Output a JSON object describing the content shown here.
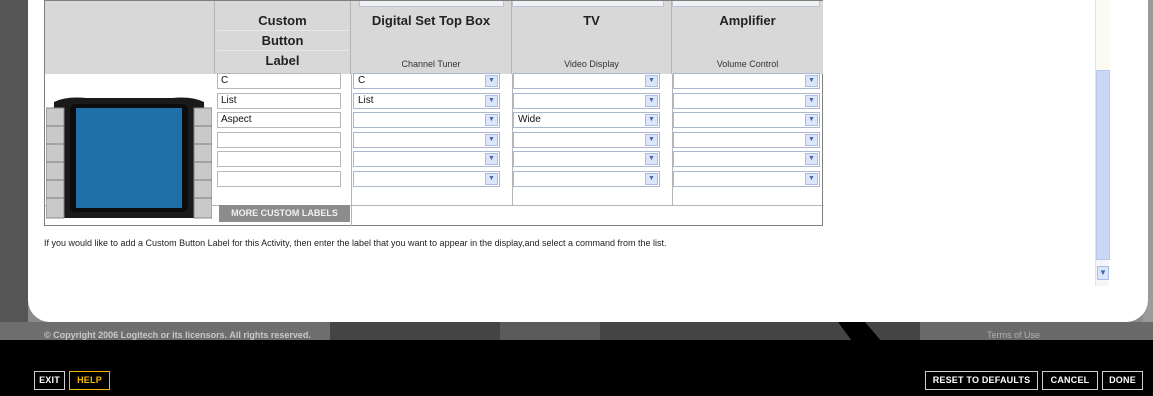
{
  "table": {
    "columns": [
      {
        "title": "Custom Button Label",
        "title_lines": [
          "Custom",
          "Button",
          "Label"
        ],
        "subtitle": ""
      },
      {
        "title": "Digital Set Top Box",
        "subtitle": "Channel Tuner"
      },
      {
        "title": "TV",
        "subtitle": "Video Display"
      },
      {
        "title": "Amplifier",
        "subtitle": "Volume Control"
      }
    ],
    "rows": [
      {
        "label": "C",
        "set_top_box": "C",
        "tv": "",
        "amplifier": ""
      },
      {
        "label": "List",
        "set_top_box": "List",
        "tv": "",
        "amplifier": ""
      },
      {
        "label": "Aspect",
        "set_top_box": "",
        "tv": "Wide",
        "amplifier": ""
      },
      {
        "label": "",
        "set_top_box": "",
        "tv": "",
        "amplifier": ""
      },
      {
        "label": "",
        "set_top_box": "",
        "tv": "",
        "amplifier": ""
      },
      {
        "label": "",
        "set_top_box": "",
        "tv": "",
        "amplifier": ""
      }
    ],
    "more_button": "MORE CUSTOM LABELS"
  },
  "info_text": "If you would like to add a Custom Button Label for this Activity, then enter the label that you want to appear in the display,and select a command from the list.",
  "footer": {
    "copyright": "© Copyright 2006 Logitech or its licensors. All rights reserved.",
    "terms": "Terms of Use",
    "exit": "EXIT",
    "help": "HELP",
    "reset": "RESET TO DEFAULTS",
    "cancel": "CANCEL",
    "done": "DONE"
  },
  "colors": {
    "accent_help": "#f5b800",
    "header_bg": "#d8d8d8",
    "screen_blue": "#1f6fa8",
    "scroll_thumb": "#c9d8f7"
  },
  "icons": {
    "dropdown": "chevron-down-icon",
    "scroll_down": "chevron-down-icon"
  }
}
